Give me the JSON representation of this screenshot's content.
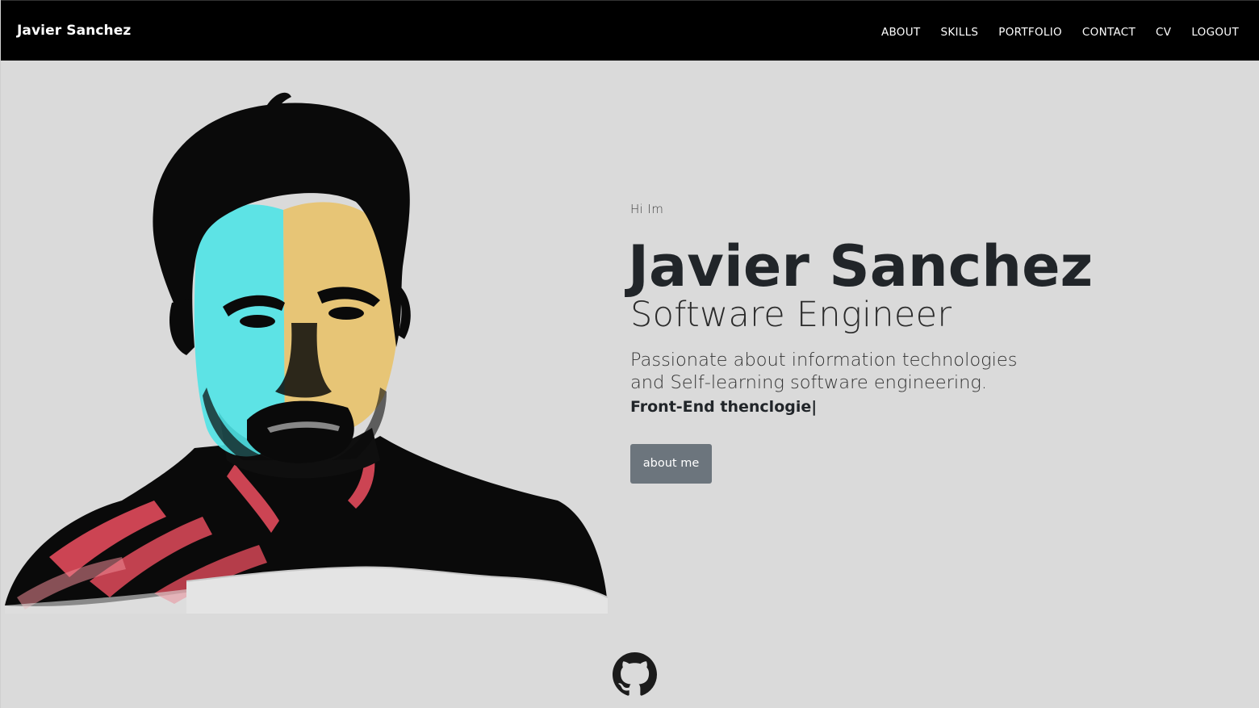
{
  "navbar": {
    "brand": "Javier Sanchez",
    "links": [
      "ABOUT",
      "SKILLS",
      "PORTFOLIO",
      "CONTACT",
      "CV",
      "LOGOUT"
    ]
  },
  "hero": {
    "greeting": "Hi Im",
    "name": "Javier Sanchez",
    "title": "Software Engineer",
    "description": "Passionate about information technologies and Self-learning software engineering.",
    "typed_text": "Front-End thenclogie",
    "cursor": "|",
    "button_label": "about me"
  },
  "footer": {
    "social_icon": "github-icon"
  },
  "colors": {
    "navbar_bg": "#000000",
    "page_bg": "#dadada",
    "button_bg": "#6c757d",
    "portrait_cyan": "#4fe3e6",
    "portrait_orange": "#e8c26a",
    "portrait_red": "#ef4f60"
  }
}
